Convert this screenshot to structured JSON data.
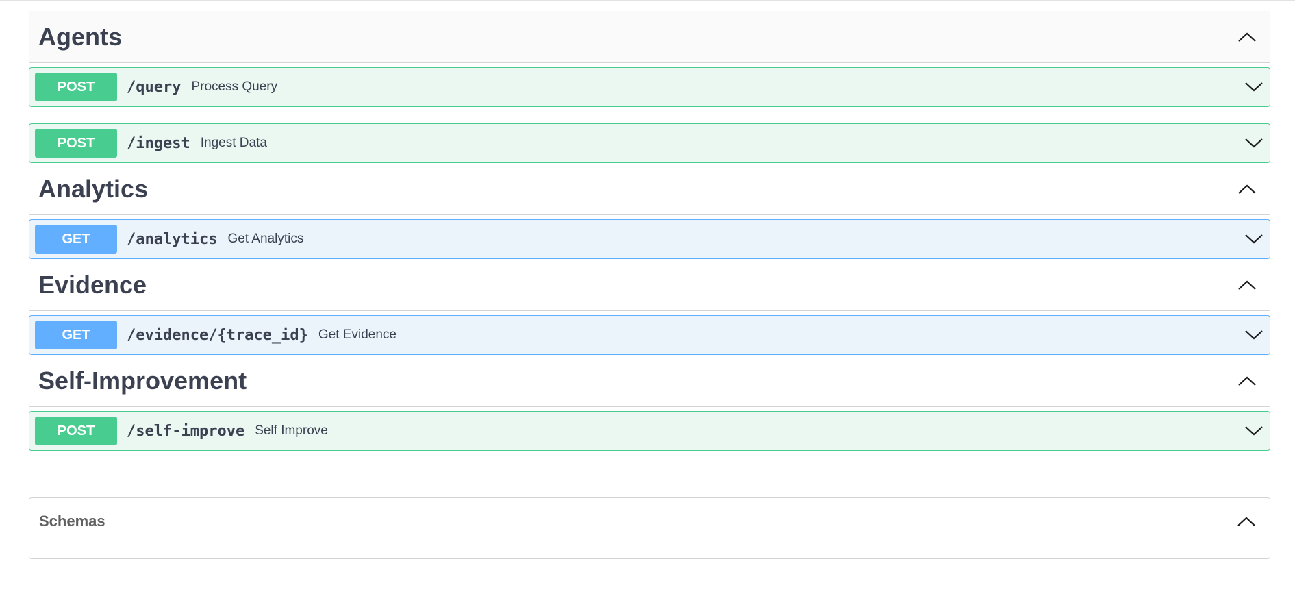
{
  "sections": [
    {
      "title": "Agents",
      "operations": [
        {
          "method": "POST",
          "path": "/query",
          "summary": "Process Query"
        },
        {
          "method": "POST",
          "path": "/ingest",
          "summary": "Ingest Data"
        }
      ]
    },
    {
      "title": "Analytics",
      "operations": [
        {
          "method": "GET",
          "path": "/analytics",
          "summary": "Get Analytics"
        }
      ]
    },
    {
      "title": "Evidence",
      "operations": [
        {
          "method": "GET",
          "path": "/evidence/{trace_id}",
          "summary": "Get Evidence"
        }
      ]
    },
    {
      "title": "Self-Improvement",
      "operations": [
        {
          "method": "POST",
          "path": "/self-improve",
          "summary": "Self Improve"
        }
      ]
    }
  ],
  "schemas": {
    "title": "Schemas"
  },
  "colors": {
    "post": "#49cc90",
    "get": "#61affe",
    "text": "#3b4151"
  },
  "icons": {
    "section_toggle": "chevron-up-icon",
    "operation_toggle": "chevron-down-icon"
  }
}
